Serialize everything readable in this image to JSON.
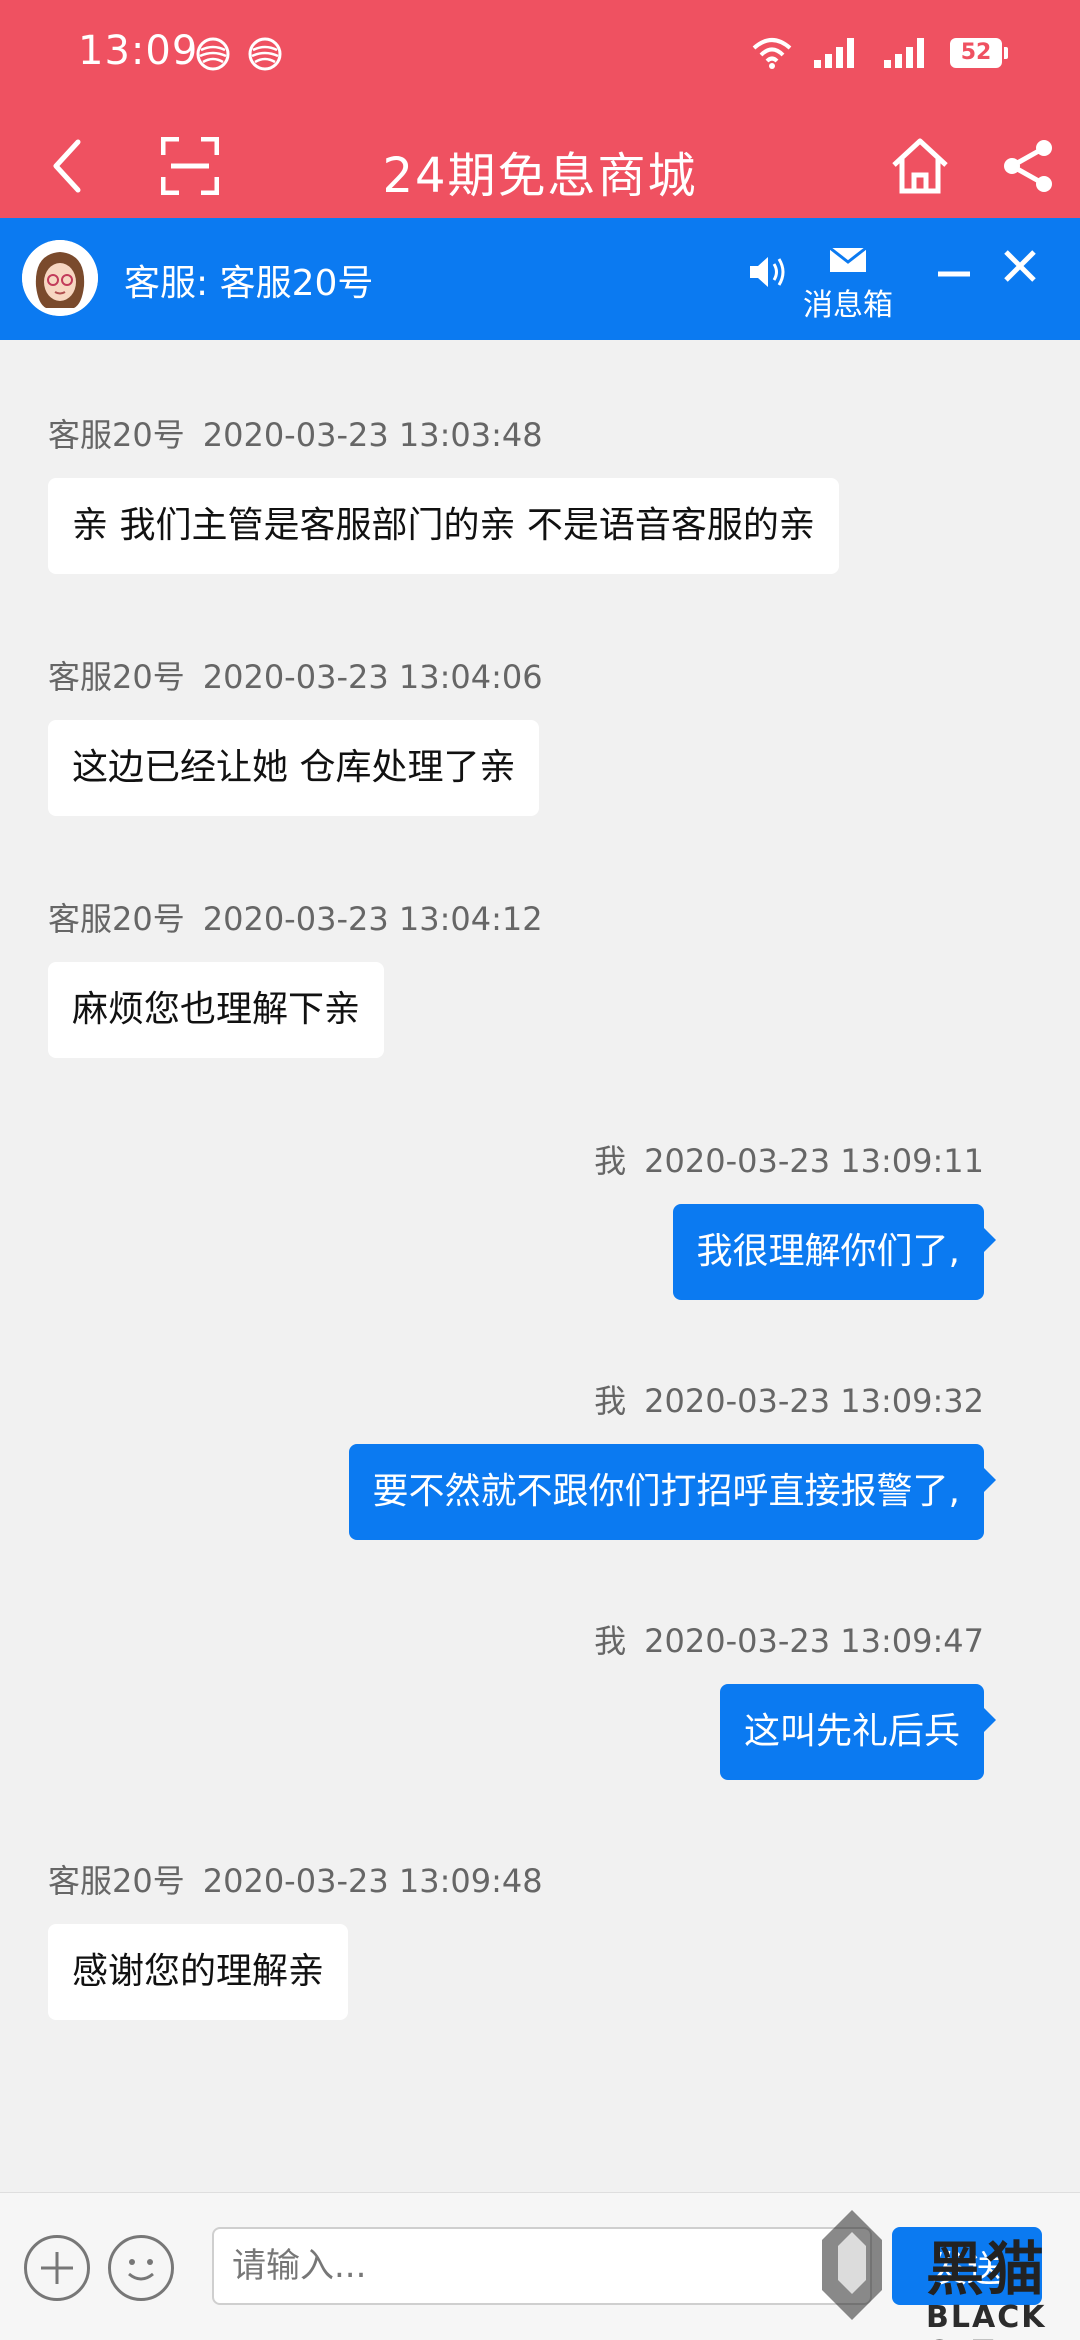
{
  "status_bar": {
    "time": "13:09",
    "battery": "52"
  },
  "header": {
    "title": "24期免息商城"
  },
  "service": {
    "agent_label": "客服: 客服20号",
    "inbox_label": "消息箱"
  },
  "messages": [
    {
      "direction": "in",
      "sender": "客服20号",
      "time": "2020-03-23 13:03:48",
      "text": "亲 我们主管是客服部门的亲 不是语音客服的亲"
    },
    {
      "direction": "in",
      "sender": "客服20号",
      "time": "2020-03-23 13:04:06",
      "text": "这边已经让她 仓库处理了亲"
    },
    {
      "direction": "in",
      "sender": "客服20号",
      "time": "2020-03-23 13:04:12",
      "text": "麻烦您也理解下亲"
    },
    {
      "direction": "out",
      "sender": "我",
      "time": "2020-03-23 13:09:11",
      "text": "我很理解你们了,"
    },
    {
      "direction": "out",
      "sender": "我",
      "time": "2020-03-23 13:09:32",
      "text": "要不然就不跟你们打招呼直接报警了,"
    },
    {
      "direction": "out",
      "sender": "我",
      "time": "2020-03-23 13:09:47",
      "text": "这叫先礼后兵"
    },
    {
      "direction": "in",
      "sender": "客服20号",
      "time": "2020-03-23 13:09:48",
      "text": "感谢您的理解亲"
    }
  ],
  "input": {
    "placeholder": "请输入...",
    "send_label": "发送"
  },
  "watermark": {
    "brand_cn": "黑猫",
    "brand_en": "BLACK CAT"
  },
  "colors": {
    "header_red": "#ef5161",
    "accent_blue": "#0b7af1",
    "chat_bg": "#f1f1f1"
  }
}
